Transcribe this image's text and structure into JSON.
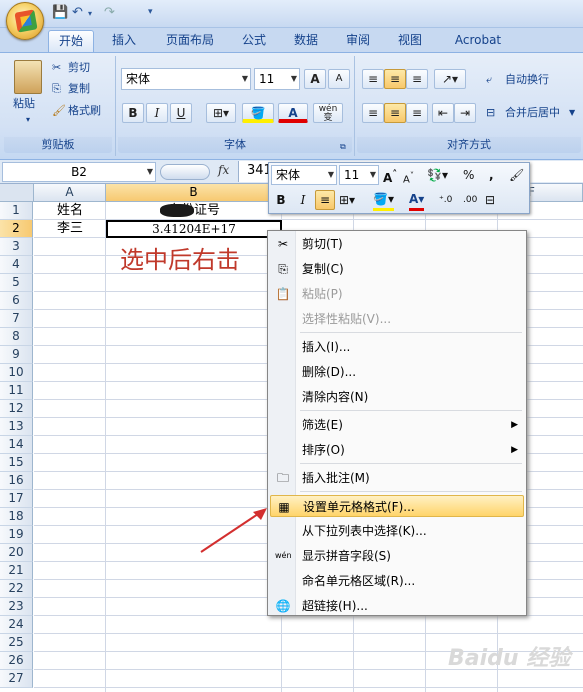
{
  "quick_access": {
    "save_icon": "💾",
    "undo_icon": "↶",
    "redo_icon": "↷",
    "customize": "▾"
  },
  "tabs": [
    "开始",
    "插入",
    "页面布局",
    "公式",
    "数据",
    "审阅",
    "视图",
    "Acrobat"
  ],
  "ribbon": {
    "clipboard": {
      "paste": "粘贴",
      "cut": "剪切",
      "copy": "复制",
      "format_painter": "格式刷",
      "label": "剪贴板"
    },
    "font": {
      "name": "宋体",
      "size": "11",
      "grow": "A",
      "shrink": "A",
      "bold": "B",
      "italic": "I",
      "underline": "U",
      "phonetic": "wén 变",
      "label": "字体"
    },
    "alignment": {
      "wrap_text": "自动换行",
      "merge_center": "合并后居中",
      "label": "对齐方式"
    }
  },
  "formula_bar": {
    "name_box": "B2",
    "fx": "fx",
    "value": "341"
  },
  "sheet": {
    "columns": [
      "A",
      "B",
      "C",
      "D",
      "E",
      "F"
    ],
    "rows": [
      "1",
      "2",
      "3",
      "4",
      "5",
      "6",
      "7",
      "8",
      "9",
      "10",
      "11",
      "12",
      "13",
      "14",
      "15",
      "16",
      "17",
      "18",
      "19",
      "20",
      "21",
      "22",
      "23",
      "24",
      "25",
      "26",
      "27"
    ],
    "A1": "姓名",
    "B1": "身份证号",
    "A2": "李三",
    "B2": "3.41204E+17"
  },
  "annotation": "选中后右击",
  "mini_toolbar": {
    "font": "宋体",
    "size": "11",
    "percent": "%",
    "comma": ",",
    "bold": "B",
    "italic": "I"
  },
  "context_menu": [
    {
      "label": "剪切(T)",
      "icon": "✂",
      "disabled": false
    },
    {
      "label": "复制(C)",
      "icon": "⎘",
      "disabled": false
    },
    {
      "label": "粘贴(P)",
      "icon": "📋",
      "disabled": true
    },
    {
      "label": "选择性粘贴(V)...",
      "icon": "",
      "disabled": true
    },
    {
      "label": "插入(I)...",
      "icon": "",
      "disabled": false
    },
    {
      "label": "删除(D)...",
      "icon": "",
      "disabled": false
    },
    {
      "label": "清除内容(N)",
      "icon": "",
      "disabled": false
    },
    {
      "label": "筛选(E)",
      "icon": "",
      "disabled": false,
      "submenu": true
    },
    {
      "label": "排序(O)",
      "icon": "",
      "disabled": false,
      "submenu": true
    },
    {
      "label": "插入批注(M)",
      "icon": "🗀",
      "disabled": false
    },
    {
      "label": "设置单元格格式(F)...",
      "icon": "▦",
      "disabled": false,
      "highlight": true
    },
    {
      "label": "从下拉列表中选择(K)...",
      "icon": "",
      "disabled": false
    },
    {
      "label": "显示拼音字段(S)",
      "icon": "wén",
      "disabled": false
    },
    {
      "label": "命名单元格区域(R)...",
      "icon": "",
      "disabled": false
    },
    {
      "label": "超链接(H)...",
      "icon": "🌐",
      "disabled": false
    }
  ],
  "watermark": "Baidu 经验",
  "colors": {
    "accent": "#15428b",
    "annotation": "#c0392b",
    "arrow": "#d32f2f",
    "selection": "#f7c971"
  }
}
